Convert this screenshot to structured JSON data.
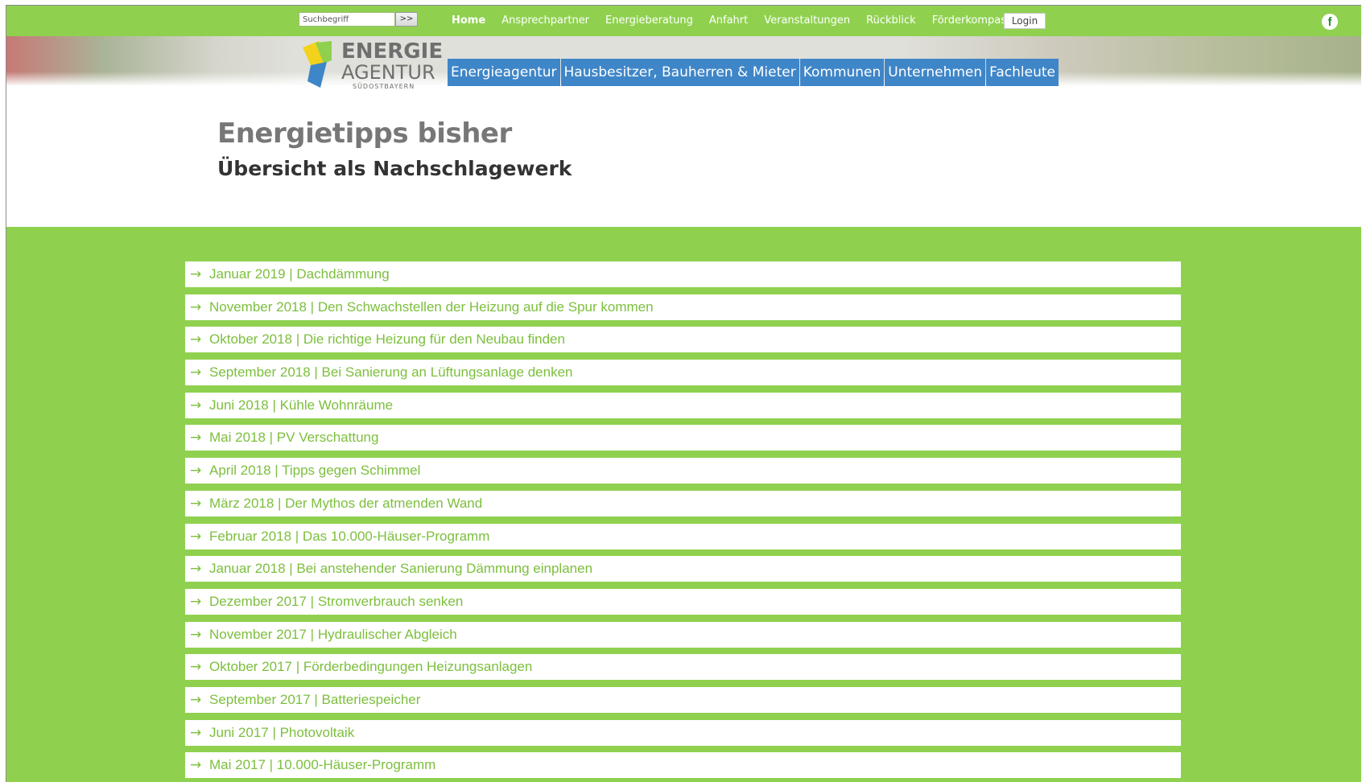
{
  "search": {
    "placeholder": "Suchbegriff",
    "button_label": ">>"
  },
  "topnav": [
    {
      "label": "Home",
      "active": true
    },
    {
      "label": "Ansprechpartner"
    },
    {
      "label": "Energieberatung"
    },
    {
      "label": "Anfahrt"
    },
    {
      "label": "Veranstaltungen"
    },
    {
      "label": "Rückblick"
    },
    {
      "label": "Förderkompass"
    }
  ],
  "login_label": "Login",
  "facebook_icon": "facebook-icon",
  "logo": {
    "line1": "ENERGIE",
    "line2": "AGENTUR",
    "line3": "SÜDOSTBAYERN"
  },
  "mainnav": [
    {
      "label": "Energieagentur"
    },
    {
      "label": "Hausbesitzer, Bauherren & Mieter"
    },
    {
      "label": "Kommunen"
    },
    {
      "label": "Unternehmen"
    },
    {
      "label": "Fachleute"
    }
  ],
  "page": {
    "title": "Energietipps bisher",
    "subtitle": "Übersicht als Nachschlagewerk"
  },
  "tips": [
    "Januar 2019 | Dachdämmung",
    "November 2018 | Den Schwachstellen der Heizung auf die Spur kommen",
    "Oktober 2018 | Die richtige Heizung für den Neubau finden",
    "September 2018 | Bei Sanierung an Lüftungsanlage denken",
    "Juni 2018 | Kühle Wohnräume",
    "Mai 2018 | PV Verschattung",
    "April 2018 | Tipps gegen Schimmel",
    "März 2018 | Der Mythos der atmenden Wand",
    "Februar 2018 | Das 10.000-Häuser-Programm",
    "Januar 2018 | Bei anstehender Sanierung Dämmung einplanen",
    "Dezember 2017 | Stromverbrauch senken",
    "November 2017 | Hydraulischer Abgleich",
    "Oktober 2017 | Förderbedingungen Heizungsanlagen",
    "September 2017 | Batteriespeicher",
    "Juni 2017 | Photovoltaik",
    "Mai 2017 | 10.000-Häuser-Programm"
  ],
  "colors": {
    "green": "#8fd14f",
    "nav_blue": "#3f86c8",
    "link_green": "#7cbf3c"
  }
}
